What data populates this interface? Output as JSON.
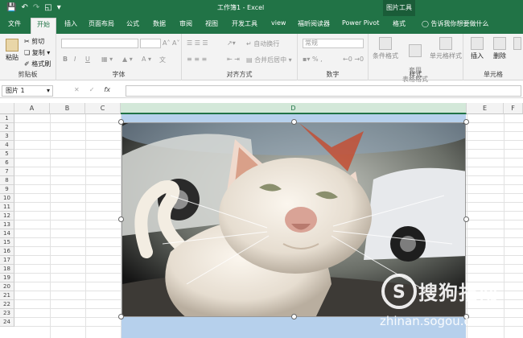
{
  "window": {
    "title": "工作簿1 - Excel",
    "picture_tools": "图片工具"
  },
  "tabs": [
    {
      "label": "文件"
    },
    {
      "label": "开始"
    },
    {
      "label": "插入"
    },
    {
      "label": "页面布局"
    },
    {
      "label": "公式"
    },
    {
      "label": "数据"
    },
    {
      "label": "审阅"
    },
    {
      "label": "视图"
    },
    {
      "label": "开发工具"
    },
    {
      "label": "view"
    },
    {
      "label": "福昕阅读器"
    },
    {
      "label": "Power Pivot"
    },
    {
      "label": "格式"
    }
  ],
  "tellme": "告诉我你想要做什么",
  "ribbon": {
    "clipboard": {
      "paste": "粘贴",
      "cut": "剪切",
      "copy": "复制",
      "format_painter": "格式刷",
      "label": "剪贴板"
    },
    "font": {
      "label": "字体",
      "bold": "B",
      "italic": "I",
      "underline": "U",
      "font_color": "A"
    },
    "align": {
      "wrap": "自动换行",
      "merge": "合并后居中",
      "label": "对齐方式"
    },
    "number": {
      "format": "常规",
      "label": "数字"
    },
    "styles": {
      "cond": "条件格式",
      "table": "套用\n表格格式",
      "cell": "单元格样式",
      "label": "样式"
    },
    "cells": {
      "insert": "插入",
      "delete": "删除",
      "label": "单元格"
    }
  },
  "formula_bar": {
    "name_box": "图片 1",
    "cancel": "✕",
    "enter": "✓",
    "fx": "fx",
    "value": ""
  },
  "columns": [
    "A",
    "B",
    "C",
    "D",
    "E",
    "F"
  ],
  "rows": [
    "1",
    "2",
    "3",
    "4",
    "5",
    "6",
    "7",
    "8",
    "9",
    "10",
    "11",
    "12",
    "13",
    "14",
    "15",
    "16",
    "17",
    "18",
    "19",
    "20",
    "21",
    "22",
    "23",
    "24"
  ],
  "watermark": {
    "brand": "搜狗指南",
    "url": "zhinan.sogou.com"
  }
}
